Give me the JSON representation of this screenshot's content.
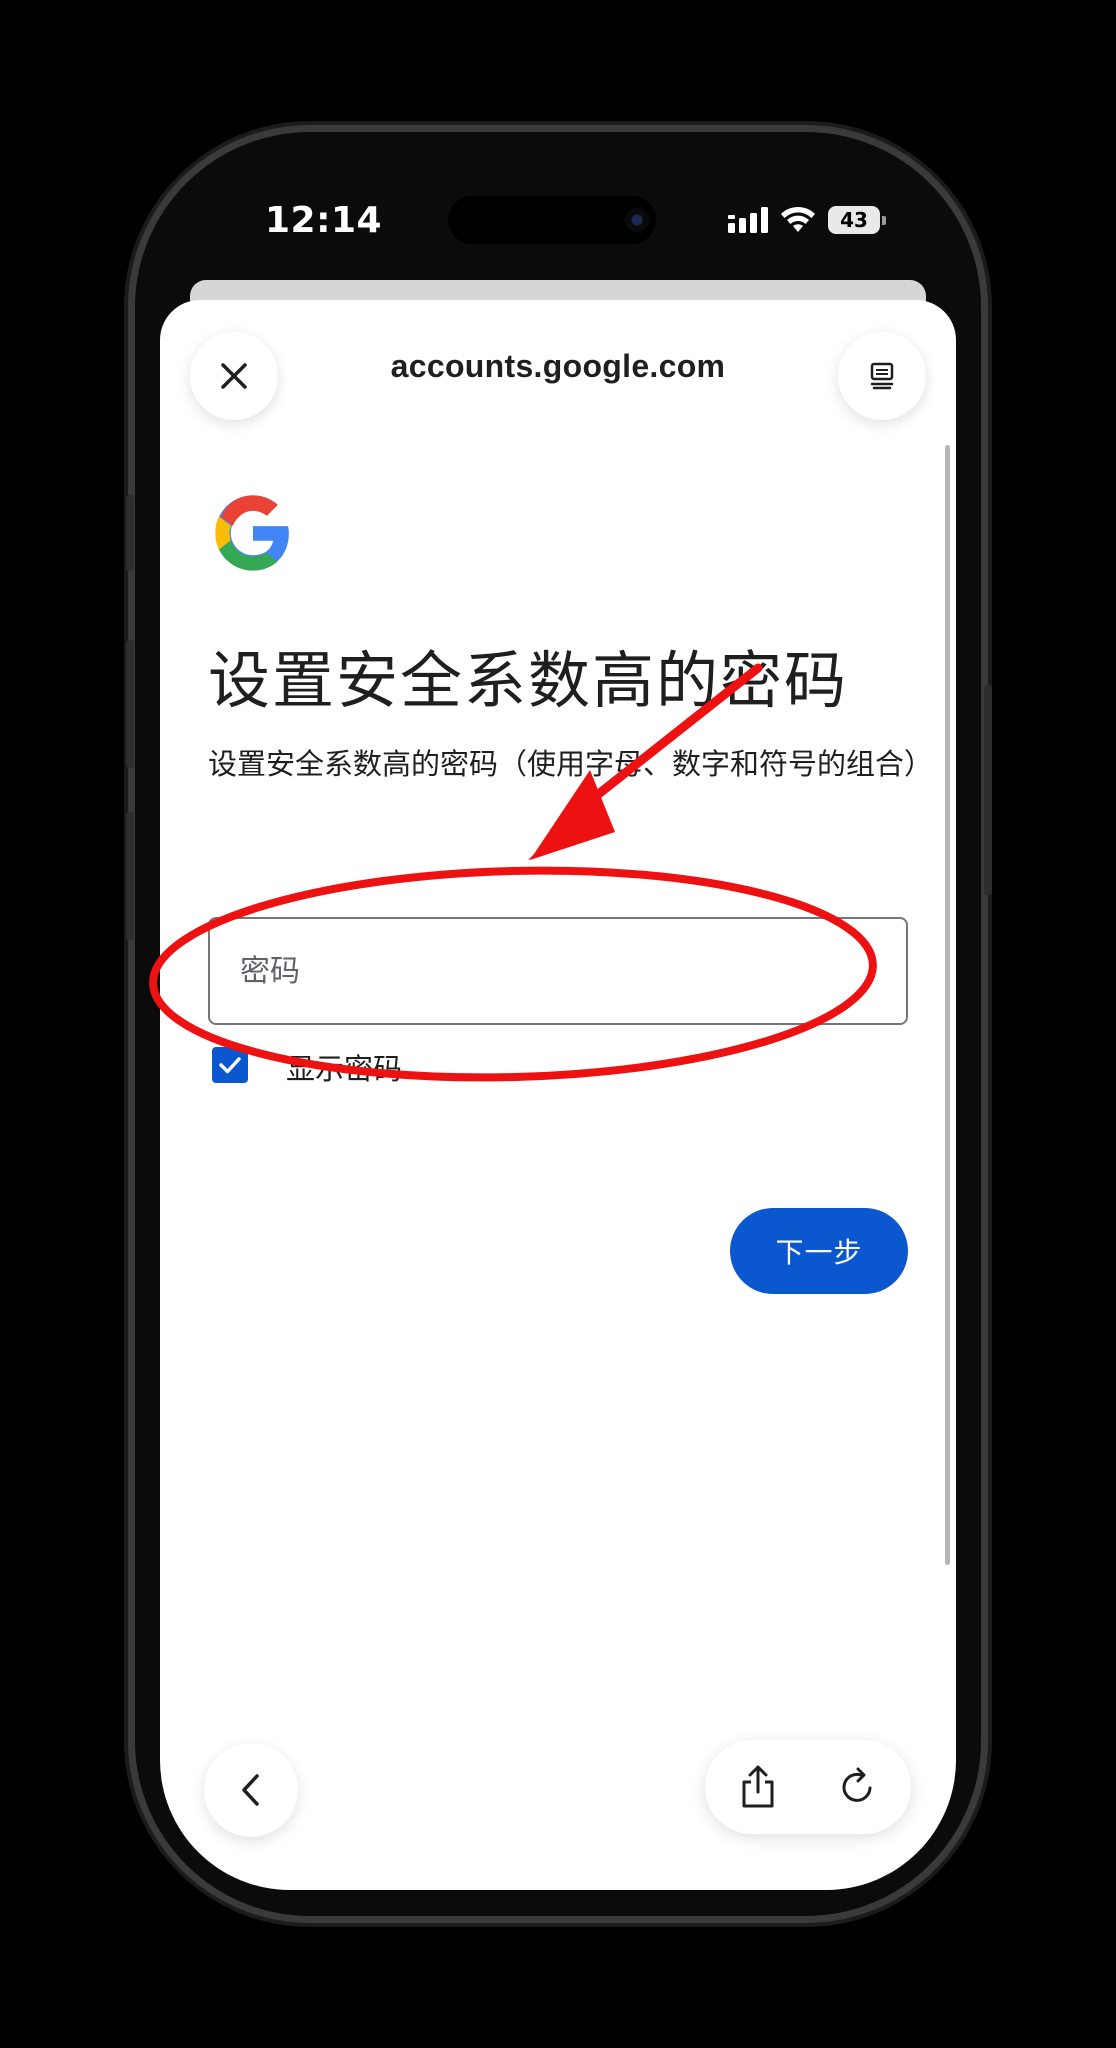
{
  "status_bar": {
    "time": "12:14",
    "battery": "43"
  },
  "browser": {
    "url": "accounts.google.com",
    "close_icon": "close-icon",
    "tabs_icon": "tab-switcher-icon",
    "back_icon": "chevron-left-icon",
    "share_icon": "share-icon",
    "reload_icon": "reload-icon"
  },
  "page": {
    "logo": "google-g-logo",
    "title": "设置安全系数高的密码",
    "subtitle": "设置安全系数高的密码（使用字母、数字和符号的组合）",
    "password_placeholder": "密码",
    "password_value": "",
    "show_password_label": "显示密码",
    "show_password_checked": true,
    "next_button": "下一步"
  },
  "colors": {
    "accent": "#0b57d0",
    "annotation": "#ee1111"
  },
  "annotation": {
    "type": "red-ellipse-with-arrow",
    "target": "password-field"
  }
}
